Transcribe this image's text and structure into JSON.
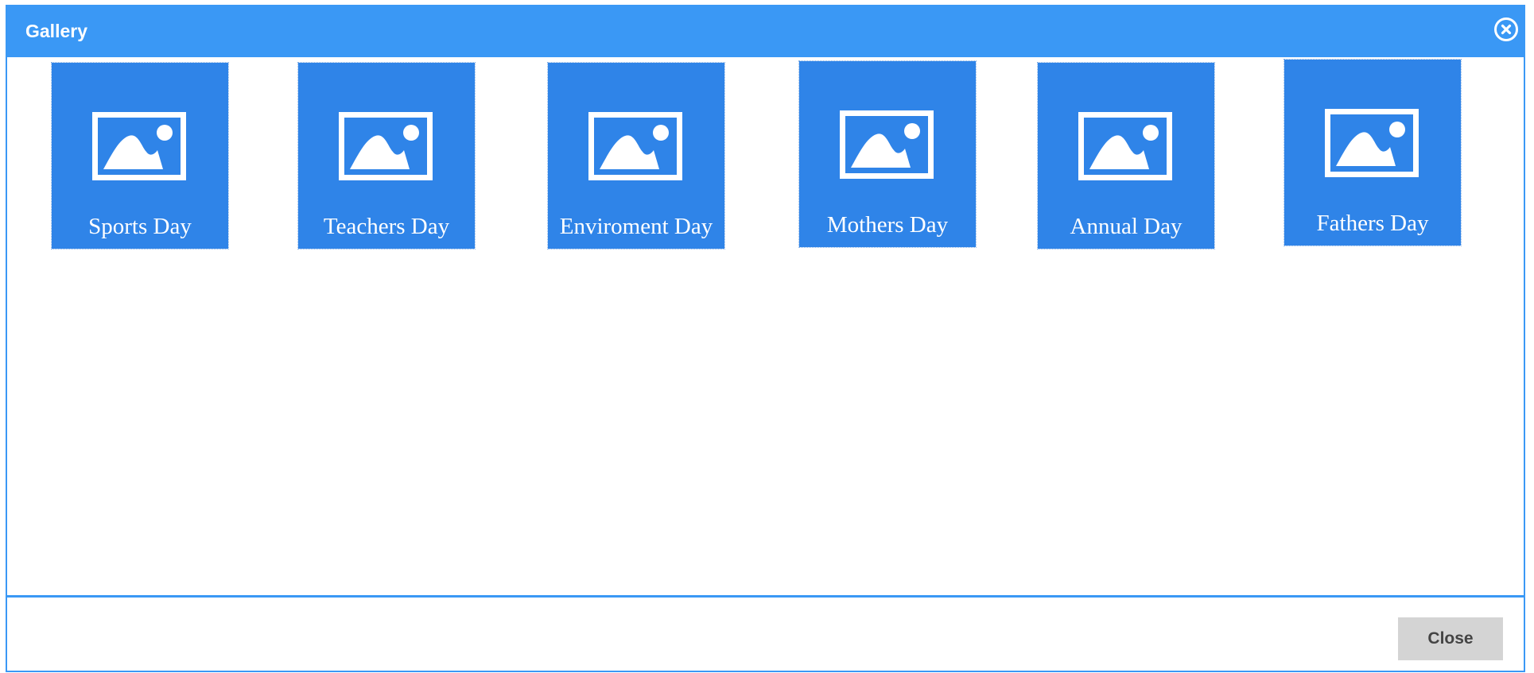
{
  "dialog": {
    "title": "Gallery",
    "close_button_label": "Close"
  },
  "colors": {
    "header": "#3a98f5",
    "tile": "#2f84e8",
    "button": "#d4d4d4"
  },
  "albums": [
    {
      "label": "Sports Day",
      "icon": "image-icon"
    },
    {
      "label": "Teachers Day",
      "icon": "image-icon"
    },
    {
      "label": "Enviroment Day",
      "icon": "image-icon"
    },
    {
      "label": "Mothers Day",
      "icon": "image-icon"
    },
    {
      "label": "Annual Day",
      "icon": "image-icon"
    },
    {
      "label": "Fathers Day",
      "icon": "image-icon"
    }
  ]
}
